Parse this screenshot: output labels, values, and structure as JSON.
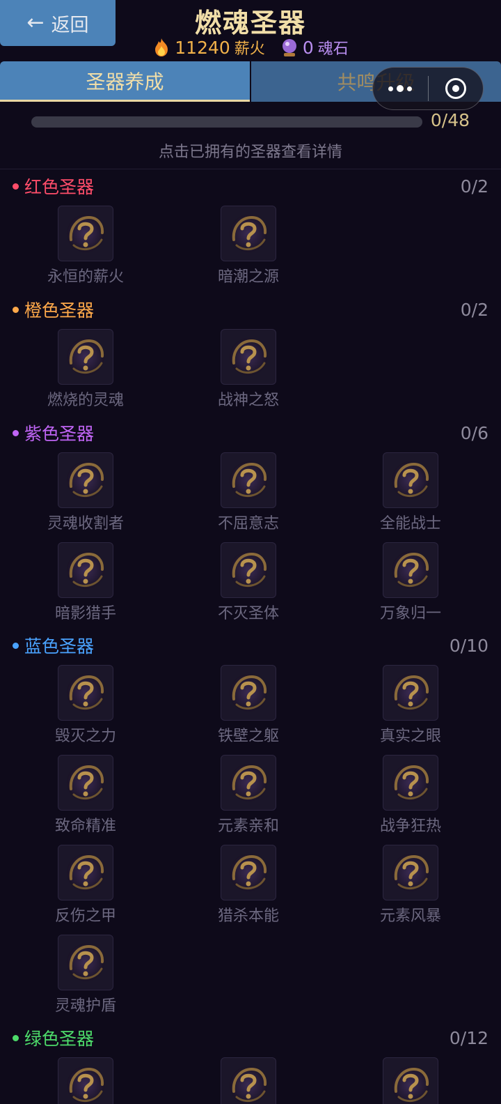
{
  "header": {
    "back_label": "返回",
    "title": "燃魂圣器",
    "fire_value": "11240",
    "fire_unit": "薪火",
    "soul_value": "0",
    "soul_unit": "魂石"
  },
  "tabs": [
    {
      "label": "圣器养成",
      "active": true
    },
    {
      "label": "共鸣升级",
      "active": false
    }
  ],
  "progress": {
    "owned": 0,
    "total": 48,
    "text": "0/48"
  },
  "hint": "点击已拥有的圣器查看详情",
  "sections": [
    {
      "name": "红色圣器",
      "count": "0/2",
      "color": "#ff4d6a",
      "items": [
        "永恒的薪火",
        "暗潮之源"
      ]
    },
    {
      "name": "橙色圣器",
      "count": "0/2",
      "color": "#ffa94a",
      "items": [
        "燃烧的灵魂",
        "战神之怒"
      ]
    },
    {
      "name": "紫色圣器",
      "count": "0/6",
      "color": "#c065f5",
      "items": [
        "灵魂收割者",
        "不屈意志",
        "全能战士",
        "暗影猎手",
        "不灭圣体",
        "万象归一"
      ]
    },
    {
      "name": "蓝色圣器",
      "count": "0/10",
      "color": "#4aa3ff",
      "items": [
        "毁灭之力",
        "铁壁之躯",
        "真实之眼",
        "致命精准",
        "元素亲和",
        "战争狂热",
        "反伤之甲",
        "猎杀本能",
        "元素风暴",
        "灵魂护盾"
      ]
    },
    {
      "name": "绿色圣器",
      "count": "0/12",
      "color": "#4ddb6a",
      "items": [
        "",
        "",
        ""
      ]
    }
  ],
  "colors": {
    "accent_gold": "#f1dea8",
    "tab_blue": "#4c83b8",
    "background": "#0e0a1a"
  }
}
